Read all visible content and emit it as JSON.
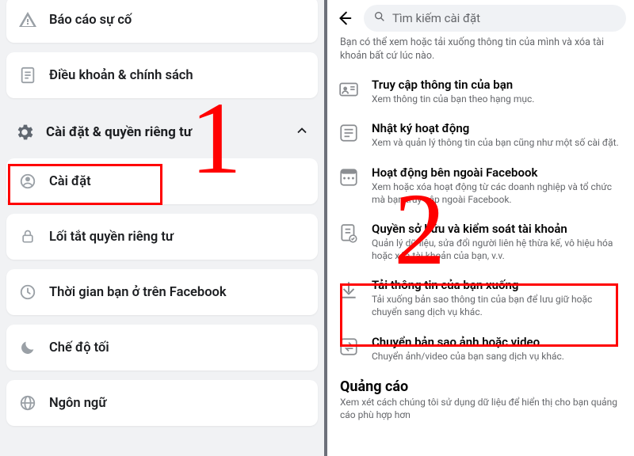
{
  "left": {
    "top_items": [
      {
        "icon": "warning-icon",
        "label": "Báo cáo sự cố"
      },
      {
        "icon": "doc-icon",
        "label": "Điều khoản & chính sách"
      }
    ],
    "section_header": "Cài đặt & quyền riêng tư",
    "section_items": [
      {
        "icon": "gear-small-icon",
        "label": "Cài đặt"
      },
      {
        "icon": "lock-icon",
        "label": "Lối tắt quyền riêng tư"
      },
      {
        "icon": "clock-icon",
        "label": "Thời gian bạn ở trên Facebook"
      },
      {
        "icon": "moon-icon",
        "label": "Chế độ tối"
      },
      {
        "icon": "globe-icon",
        "label": "Ngôn ngữ"
      }
    ]
  },
  "right": {
    "search_placeholder": "Tìm kiếm cài đặt",
    "intro": "Bạn có thể xem hoặc tải xuống thông tin của mình và xóa tài khoản bất cứ lúc nào.",
    "items": [
      {
        "icon": "id-card-icon",
        "title": "Truy cập thông tin của bạn",
        "sub": "Xem thông tin của bạn theo hạng mục."
      },
      {
        "icon": "list-icon",
        "title": "Nhật ký hoạt động",
        "sub": "Xem và quản lý thông tin của bạn cũng như một số cài đặt."
      },
      {
        "icon": "app-icon",
        "title": "Hoạt động bên ngoài Facebook",
        "sub": "Xem hoặc xóa hoạt động từ các doanh nghiệp và tổ chức mà bạn truy cập ngoài Facebook."
      },
      {
        "icon": "doc-check-icon",
        "title": "Quyền sở hữu và kiểm soát tài khoản",
        "sub": "Quản lý dữ liệu, sửa đổi người liên hệ thừa kế, vô hiệu hóa hoặc xóa tài khoản của bạn, v.v."
      },
      {
        "icon": "download-icon",
        "title": "Tải thông tin của bạn xuống",
        "sub": "Tải xuống bản sao thông tin của bạn để lưu giữ hoặc chuyển sang dịch vụ khác."
      },
      {
        "icon": "transfer-icon",
        "title": "Chuyển bản sao ảnh hoặc video",
        "sub": "Chuyển ảnh/video của bạn sang dịch vụ khác."
      }
    ],
    "ads_header": "Quảng cáo",
    "ads_sub": "Xem xét cách chúng tôi sử dụng dữ liệu để hiển thị cho bạn quảng cáo phù hợp hơn"
  },
  "annotations": {
    "num1": "1",
    "num2": "2"
  }
}
